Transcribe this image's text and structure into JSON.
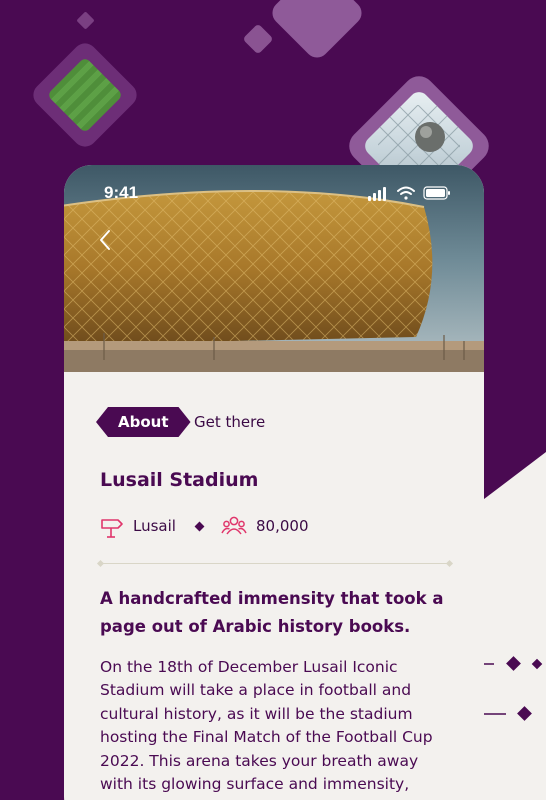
{
  "colors": {
    "brand_purple": "#4a0a52",
    "card_background": "#f3f1ee",
    "accent_pink": "#e0356b"
  },
  "status_bar": {
    "time": "9:41",
    "icons": [
      "signal-icon",
      "wifi-icon",
      "battery-icon"
    ]
  },
  "header": {
    "back_icon": "chevron-left-icon"
  },
  "tabs": [
    {
      "label": "About",
      "active": true
    },
    {
      "label": "Get there",
      "active": false
    }
  ],
  "stadium": {
    "name": "Lusail Stadium",
    "location": "Lusail",
    "location_icon": "signpost-icon",
    "capacity": "80,000",
    "capacity_icon": "people-icon",
    "lead": "A handcrafted immensity that took a page out of Arabic history books.",
    "description": "On the 18th of December Lusail Iconic Stadium will take a place in football and cultural history, as it will be the stadium hosting the Final Match of the Football Cup 2022. This arena takes your breath away with its glowing surface and immensity,"
  }
}
